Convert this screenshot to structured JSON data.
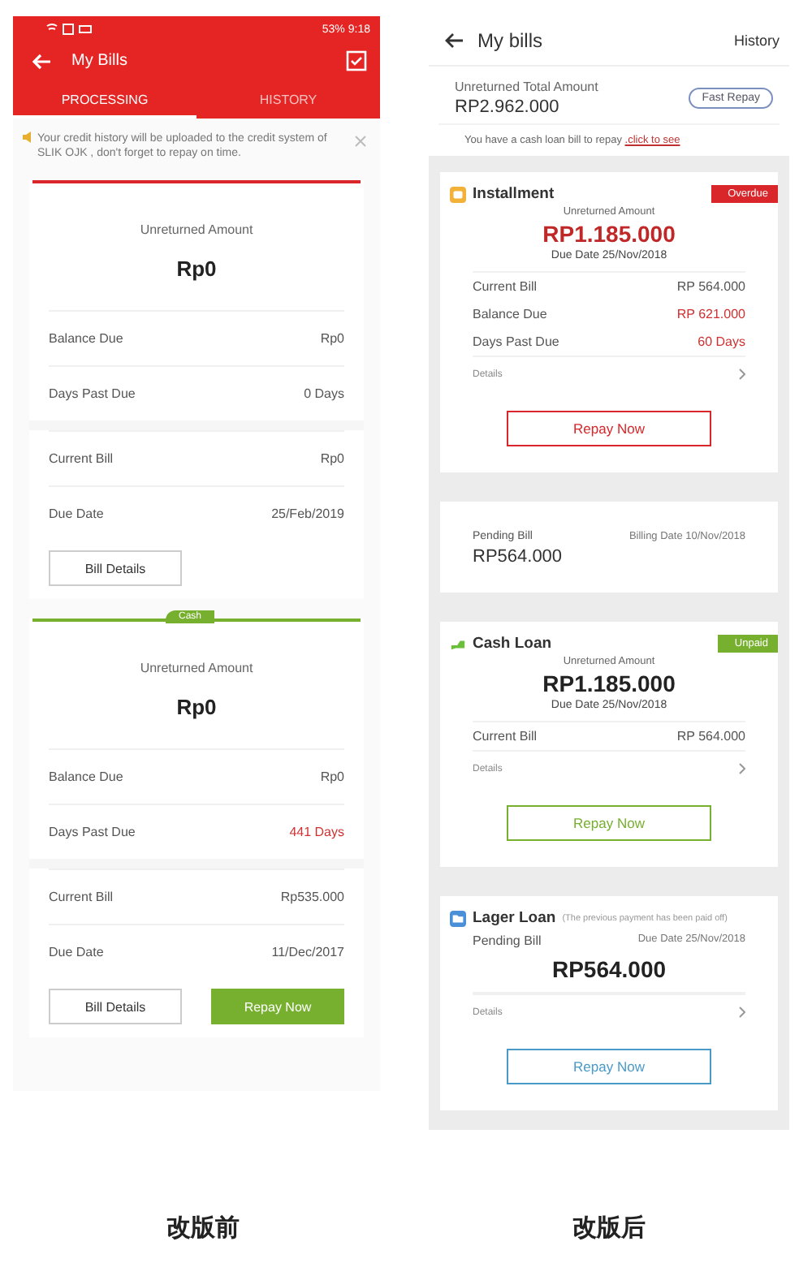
{
  "before": {
    "status_bar": {
      "battery": "53%",
      "time": "9:18"
    },
    "title": "My Bills",
    "tabs": [
      {
        "label": "PROCESSING",
        "selected": true
      },
      {
        "label": "HISTORY",
        "selected": false
      }
    ],
    "notice": "Your credit history will be uploaded to the credit system of SLIK OJK , don't forget to repay on time.",
    "cards": [
      {
        "color": "#d9262a",
        "unreturned_label": "Unreturned Amount",
        "amount": "Rp0",
        "rows": [
          {
            "label": "Balance Due",
            "value": "Rp0",
            "alert": false
          },
          {
            "label": "Days Past Due",
            "value": "0 Days",
            "alert": false
          }
        ],
        "bill_rows": [
          {
            "label": "Current Bill",
            "value": "Rp0",
            "alert": false
          },
          {
            "label": "Due Date",
            "value": "25/Feb/2019",
            "alert": false
          }
        ],
        "buttons": [
          {
            "label": "Bill Details",
            "primary": false
          }
        ]
      },
      {
        "color": "#76b02e",
        "tag": "Cash",
        "unreturned_label": "Unreturned Amount",
        "amount": "Rp0",
        "rows": [
          {
            "label": "Balance Due",
            "value": "Rp0",
            "alert": false
          },
          {
            "label": "Days Past Due",
            "value": "441 Days",
            "alert": true
          }
        ],
        "bill_rows": [
          {
            "label": "Current Bill",
            "value": "Rp535.000",
            "alert": false
          },
          {
            "label": "Due Date",
            "value": "11/Dec/2017",
            "alert": false
          }
        ],
        "buttons": [
          {
            "label": "Bill Details",
            "primary": false
          },
          {
            "label": "Repay Now",
            "primary": true
          }
        ]
      }
    ],
    "caption": "改版前"
  },
  "after": {
    "title": "My bills",
    "history": "History",
    "total_label": "Unreturned Total Amount",
    "total": "RP2.962.000",
    "fast_repay": "Fast Repay",
    "hint": "You have a cash loan bill to repay",
    "hint_link": ".click to see",
    "cards": [
      {
        "kind": "installment",
        "title": "Installment",
        "badge": "Overdue",
        "color": "#d9262a",
        "unreturned_label": "Unreturned Amount",
        "amount": "RP1.185.000",
        "amount_alert": true,
        "due_date": "Due Date 25/Nov/2018",
        "rows": [
          {
            "label": "Current Bill",
            "value": "RP 564.000",
            "alert": false
          },
          {
            "label": "Balance Due",
            "value": "RP 621.000",
            "alert": true
          },
          {
            "label": "Days Past Due",
            "value": "60 Days",
            "alert": true
          }
        ],
        "details": "Details",
        "button": "Repay Now"
      },
      {
        "kind": "pending",
        "label": "Pending Bill",
        "billing_date": "Billing Date 10/Nov/2018",
        "amount": "RP564.000"
      },
      {
        "kind": "cash_loan",
        "title": "Cash Loan",
        "badge": "Unpaid",
        "color": "#76b02e",
        "unreturned_label": "Unreturned Amount",
        "amount": "RP1.185.000",
        "amount_alert": false,
        "due_date": "Due Date 25/Nov/2018",
        "rows": [
          {
            "label": "Current Bill",
            "value": "RP 564.000",
            "alert": false
          }
        ],
        "details": "Details",
        "button": "Repay Now"
      },
      {
        "kind": "loan",
        "color": "#4a9ac8",
        "title": "Lager Loan",
        "note": "(The previous payment has been paid off)",
        "pending_label": "Pending Bill",
        "due_date": "Due Date 25/Nov/2018",
        "amount": "RP564.000",
        "details": "Details",
        "button": "Repay Now"
      }
    ],
    "caption": "改版后"
  }
}
